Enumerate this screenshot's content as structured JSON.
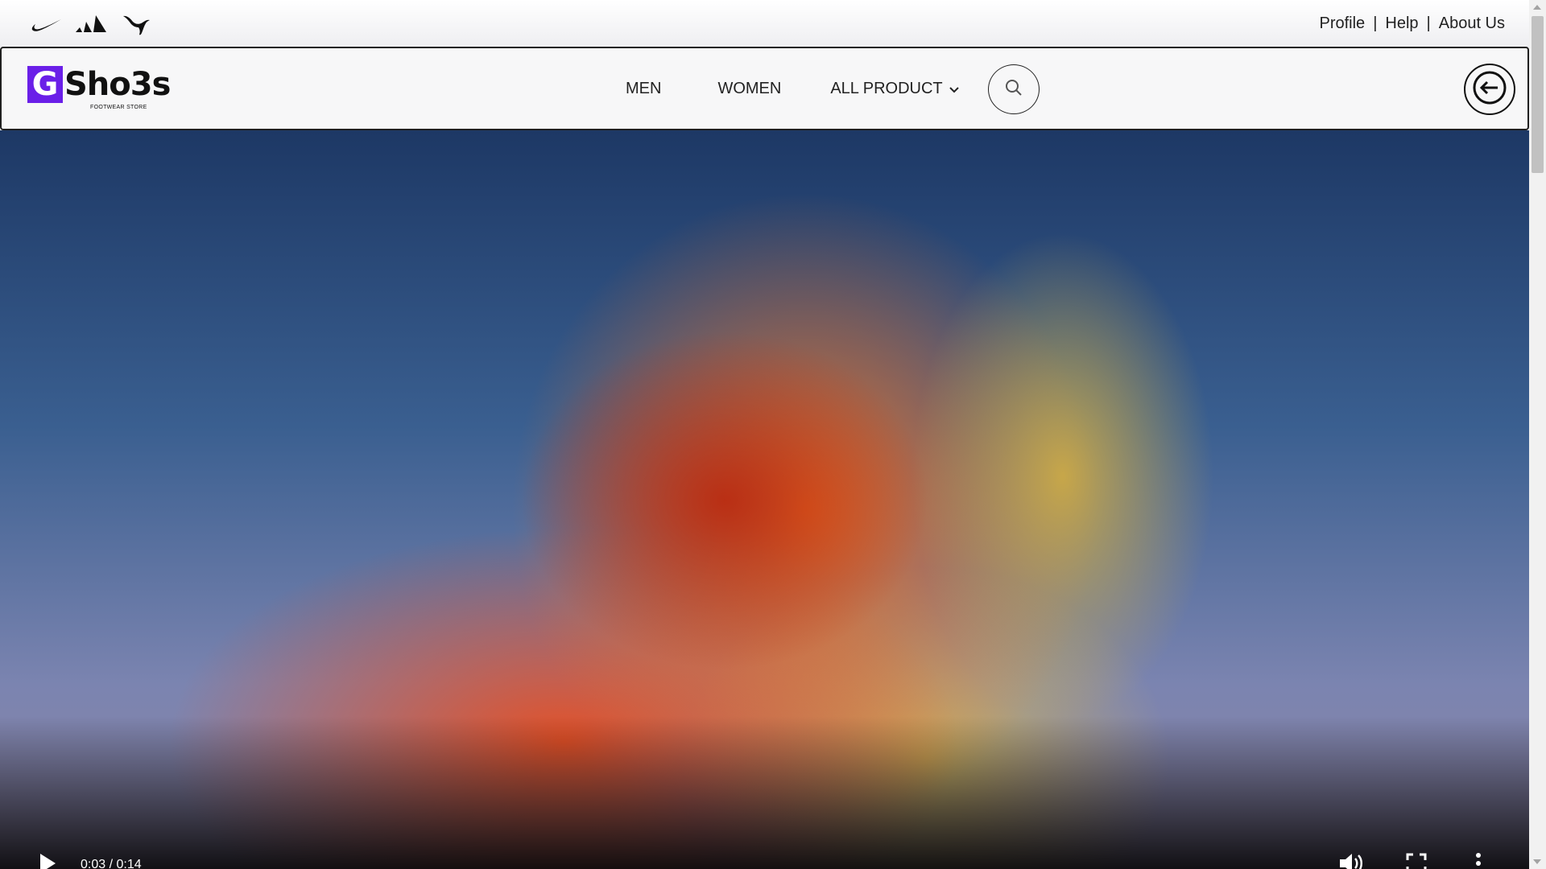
{
  "top_bar": {
    "brand_icons": [
      "nike-swoosh-icon",
      "adidas-icon",
      "puma-icon"
    ],
    "links": {
      "profile": "Profile",
      "help": "Help",
      "about": "About Us",
      "separator": "|"
    }
  },
  "navbar": {
    "logo": {
      "mark": "G",
      "word": "Sho3s",
      "tagline": "FOOTWEAR STORE"
    },
    "menu": {
      "men": "MEN",
      "women": "WOMEN",
      "all_product": "ALL PRODUCT"
    },
    "search_icon": "search-icon",
    "logout_icon": "logout-icon"
  },
  "video": {
    "time": "0:03 / 0:14",
    "controls": [
      "play-icon",
      "volume-icon",
      "fullscreen-icon",
      "more-icon"
    ]
  },
  "colors": {
    "brand_accent": "#6a1fe8",
    "navbar_border": "#1f1f1f"
  }
}
